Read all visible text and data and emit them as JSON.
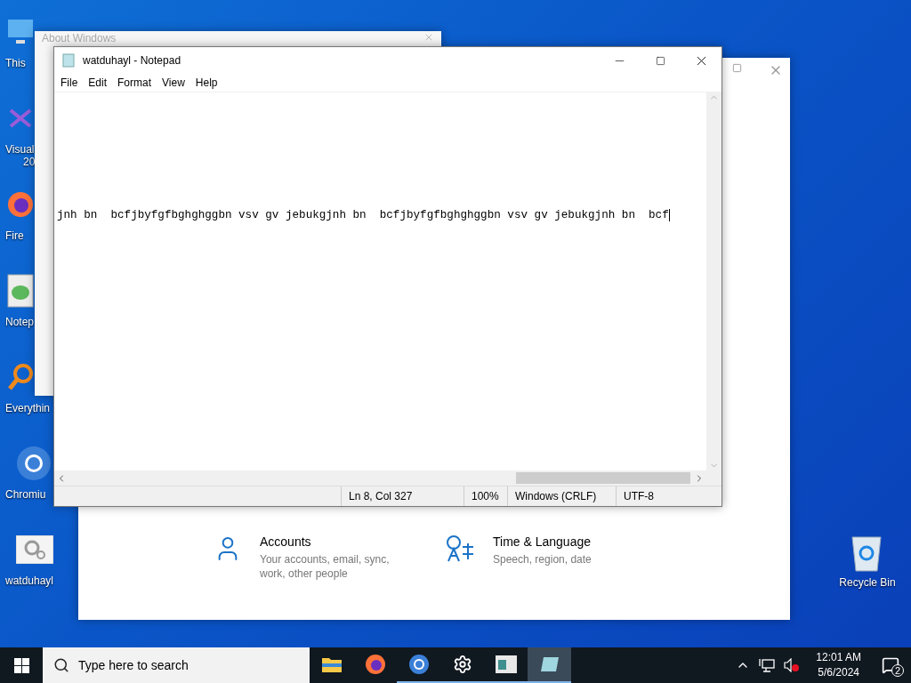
{
  "desktop_icons": [
    {
      "kind": "computer",
      "lines": [
        "This"
      ]
    },
    {
      "kind": "studio",
      "lines": [
        "Visual",
        "20"
      ]
    },
    {
      "kind": "firefox",
      "lines": [
        "Fire"
      ]
    },
    {
      "kind": "notepadpp",
      "lines": [
        "Notep"
      ]
    },
    {
      "kind": "everything",
      "lines": [
        "Everythin"
      ]
    },
    {
      "kind": "chromium",
      "lines": [
        "Chromiu"
      ]
    },
    {
      "kind": "gears",
      "lines": [
        "watduhayl"
      ]
    }
  ],
  "recycle_bin": {
    "label": "Recycle Bin"
  },
  "settings_window": {
    "items": [
      {
        "kind": "accounts",
        "title": "Accounts",
        "description": "Your accounts, email, sync, work, other people"
      },
      {
        "kind": "time",
        "title": "Time & Language",
        "description": "Speech, region, date"
      }
    ]
  },
  "about_window": {
    "title": "About Windows"
  },
  "notepad": {
    "title": "watduhayl - Notepad",
    "menu": [
      "File",
      "Edit",
      "Format",
      "View",
      "Help"
    ],
    "text": "jnh bn  bcfjbyfgfbghghggbn vsv gv jebukgjnh bn  bcfjbyfgfbghghggbn vsv gv jebukgjnh bn  bcf",
    "status": [
      "Ln 8, Col 327",
      "100%",
      "Windows (CRLF)",
      "UTF-8"
    ]
  },
  "taskbar": {
    "search_placeholder": "Type here to search",
    "apps": [
      {
        "kind": "explorer",
        "running": false,
        "selected": false
      },
      {
        "kind": "firefox",
        "running": false,
        "selected": false
      },
      {
        "kind": "chromium",
        "running": true,
        "selected": false
      },
      {
        "kind": "settings",
        "running": true,
        "selected": false
      },
      {
        "kind": "app",
        "running": true,
        "selected": false
      },
      {
        "kind": "notepad",
        "running": true,
        "selected": true
      }
    ],
    "time": "12:01 AM",
    "date": "5/6/2024",
    "notifications": "2"
  }
}
